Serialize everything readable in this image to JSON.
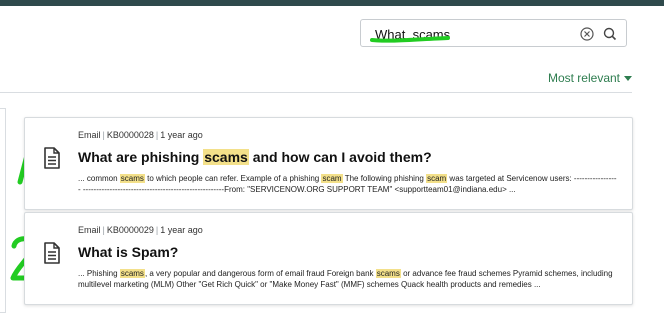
{
  "search": {
    "value": "What  scams",
    "clear_icon": "clear-circle-icon",
    "search_icon": "magnifier-icon"
  },
  "sort": {
    "label": "Most relevant",
    "accent_color": "#2e7d4f"
  },
  "annotations": {
    "color": "#22cc22",
    "labels": [
      "1",
      "2"
    ]
  },
  "results": [
    {
      "meta_type": "Email",
      "meta_id": "KB0000028",
      "meta_time": "1 year ago",
      "title_pre": "What are phishing ",
      "title_hl": "scams",
      "title_post": " and how can I avoid them?",
      "s1": "... common ",
      "s1_hl": "scams",
      "s2": " to which people can refer. Example of a phishing ",
      "s2_hl": "scam",
      "s3": " The following phishing ",
      "s3_hl": "scam",
      "s4": " was targeted at Servicenow users: ----------------- -----------------------------------------------------From: \"SERVICENOW.ORG SUPPORT TEAM\" <supportteam01@indiana.edu> ..."
    },
    {
      "meta_type": "Email",
      "meta_id": "KB0000029",
      "meta_time": "1 year ago",
      "title": "What is Spam?",
      "s1": "... Phishing ",
      "s1_hl": "scams",
      "s2": ", a very popular and dangerous form of email fraud Foreign bank ",
      "s2_hl": "scams",
      "s3": " or advance fee fraud schemes Pyramid schemes, including multilevel marketing (MLM) Other \"Get Rich Quick\" or \"Make Money Fast\" (MMF) schemes Quack health products and remedies ..."
    }
  ]
}
